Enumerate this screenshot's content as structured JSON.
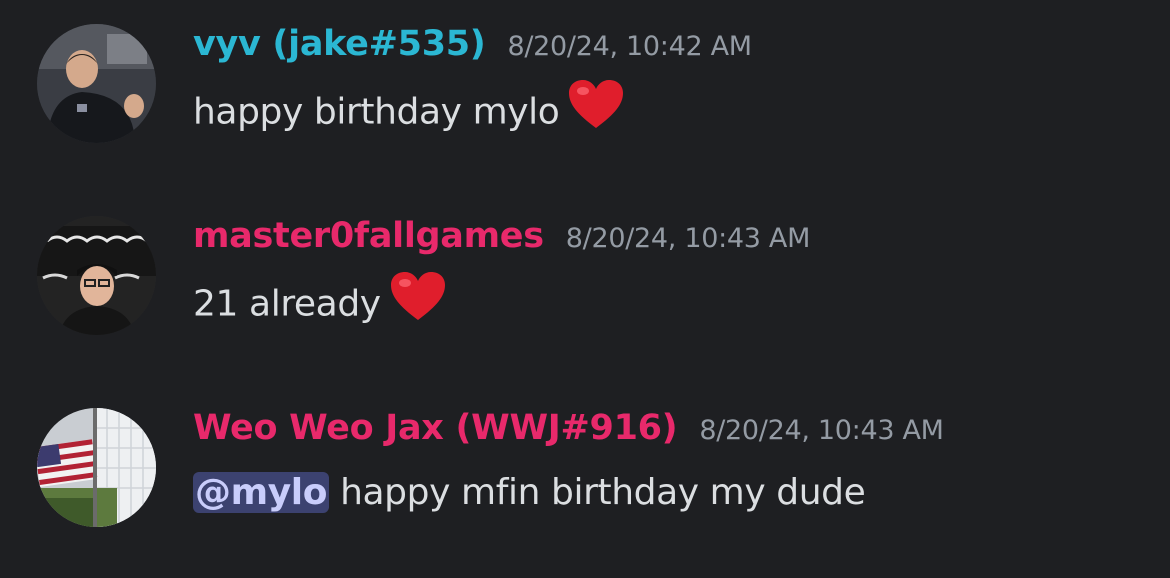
{
  "colors": {
    "background": "#1e1f22",
    "message_text": "#dbdee1",
    "timestamp": "#949ba4",
    "username_cyan": "#2bb7d3",
    "username_pink": "#e8296b",
    "mention_bg": "#3c4270",
    "mention_text": "#c9cdfb"
  },
  "messages": [
    {
      "username": "vyv (jake#535)",
      "timestamp": "8/20/24, 10:42 AM",
      "text": "happy birthday mylo",
      "emoji": "heart-emoji"
    },
    {
      "username": "master0fallgames",
      "timestamp": "8/20/24, 10:43 AM",
      "text": "21 already",
      "emoji": "heart-emoji"
    },
    {
      "username": "Weo Weo Jax (WWJ#916)",
      "timestamp": "8/20/24, 10:43 AM",
      "mention": "@mylo",
      "text": " happy mfin birthday my dude"
    }
  ]
}
